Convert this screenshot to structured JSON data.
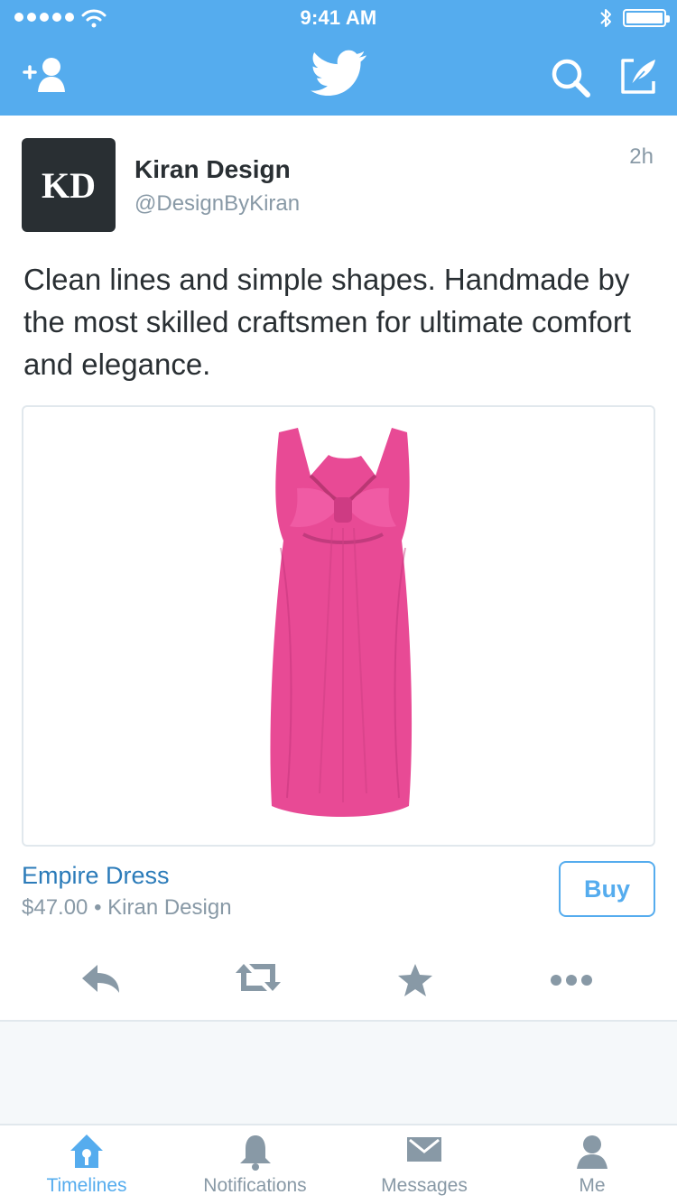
{
  "status_bar": {
    "time": "9:41 AM"
  },
  "colors": {
    "header": "#55acee",
    "link": "#2b7bb9",
    "muted": "#8899a6",
    "text": "#292f33",
    "product": "#e84a95"
  },
  "nav": {
    "icons": [
      "add-user-icon",
      "twitter-bird-logo",
      "search-icon",
      "compose-icon"
    ]
  },
  "tweet": {
    "avatar_text": "KD",
    "author_name": "Kiran Design",
    "handle": "@DesignByKiran",
    "time_ago": "2h",
    "text": "Clean lines and simple shapes. Handmade by the most skilled craftsmen for ultimate comfort and elegance.",
    "product": {
      "title": "Empire Dress",
      "meta": "$47.00 • Kiran Design",
      "buy_label": "Buy",
      "image": "pink-dress-image"
    },
    "actions": [
      "reply-icon",
      "retweet-icon",
      "favorite-icon",
      "more-icon"
    ]
  },
  "tabbar": {
    "tabs": [
      {
        "label": "Timelines",
        "icon": "home-icon",
        "active": true
      },
      {
        "label": "Notifications",
        "icon": "bell-icon",
        "active": false
      },
      {
        "label": "Messages",
        "icon": "envelope-icon",
        "active": false
      },
      {
        "label": "Me",
        "icon": "person-icon",
        "active": false
      }
    ]
  }
}
